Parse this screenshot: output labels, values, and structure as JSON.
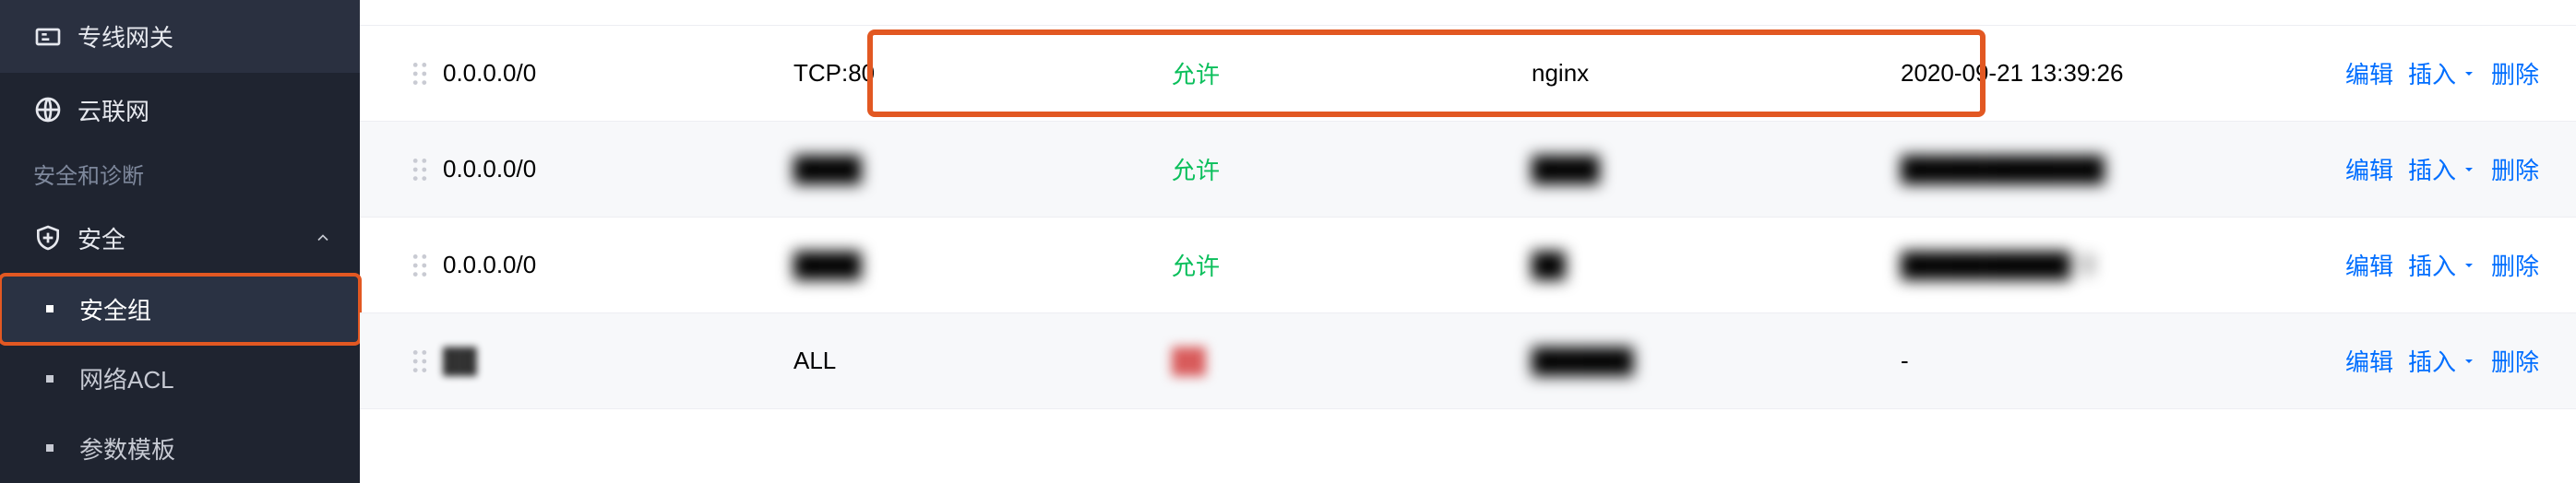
{
  "sidebar": {
    "items_top": [
      {
        "label": "专线网关",
        "icon": "gateway-icon"
      },
      {
        "label": "云联网",
        "icon": "ccn-icon"
      }
    ],
    "section_label": "安全和诊断",
    "security": {
      "label": "安全",
      "expanded": true,
      "children": [
        {
          "label": "安全组",
          "active": true
        },
        {
          "label": "网络ACL",
          "active": false
        },
        {
          "label": "参数模板",
          "active": false
        }
      ]
    }
  },
  "table": {
    "ops": {
      "edit": "编辑",
      "insert": "插入",
      "delete": "删除"
    },
    "rows": [
      {
        "source": "0.0.0.0/0",
        "proto": "TCP:80",
        "policy": "允许",
        "note": "nginx",
        "time": "2020-09-21 13:39:26",
        "highlight": true,
        "alt": false,
        "blur": false
      },
      {
        "source": "0.0.0.0/0",
        "proto": "████",
        "policy": "允许",
        "note": "████",
        "time": "████████████",
        "highlight": false,
        "alt": true,
        "blur": true
      },
      {
        "source": "0.0.0.0/0",
        "proto": "████",
        "policy": "允许",
        "note": "██",
        "time": "██████████  '2",
        "highlight": false,
        "alt": false,
        "blur": true
      },
      {
        "source": "██",
        "proto": "ALL",
        "policy": "██",
        "policy_red": true,
        "note": "██████",
        "time": "-",
        "highlight": false,
        "alt": true,
        "blur": true,
        "source_blur": true,
        "note_blur": true
      }
    ]
  }
}
